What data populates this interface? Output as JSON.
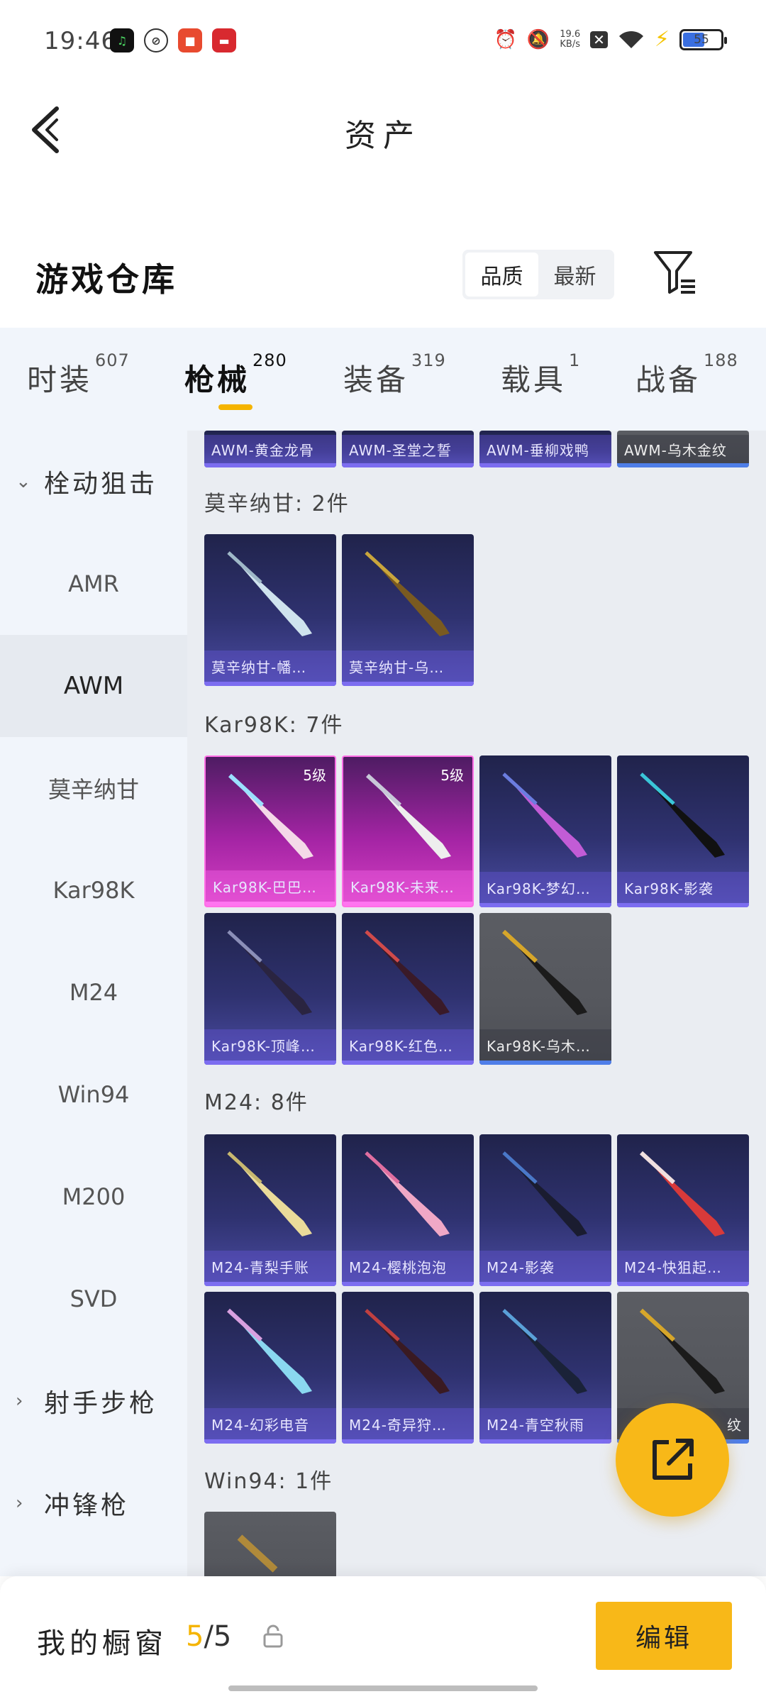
{
  "status_bar": {
    "time": "19:46",
    "network_speed": "19.6",
    "network_unit": "KB/s",
    "battery": "55"
  },
  "header": {
    "title": "资产"
  },
  "warehouse": {
    "title": "游戏仓库",
    "sort_quality": "品质",
    "sort_newest": "最新"
  },
  "tabs": [
    {
      "label": "时装",
      "count": "607"
    },
    {
      "label": "枪械",
      "count": "280"
    },
    {
      "label": "装备",
      "count": "319"
    },
    {
      "label": "载具",
      "count": "1"
    },
    {
      "label": "战备",
      "count": "188"
    }
  ],
  "sidebar": {
    "group_bolt": "栓动狙击",
    "items": [
      "AMR",
      "AWM",
      "莫辛纳甘",
      "Kar98K",
      "M24",
      "Win94",
      "M200",
      "SVD"
    ],
    "group_dmr": "射手步枪",
    "group_smg": "冲锋枪"
  },
  "content": {
    "top_row": [
      "AWM-黄金龙骨",
      "AWM-圣堂之誓",
      "AWM-垂柳戏鸭",
      "AWM-乌木金纹"
    ],
    "sections": [
      {
        "label": "莫辛纳甘: 2件",
        "items": [
          "莫辛纳甘-幡…",
          "莫辛纳甘-乌…"
        ]
      },
      {
        "label": "Kar98K: 7件",
        "items": [
          "Kar98K-巴巴…",
          "Kar98K-未来…",
          "Kar98K-梦幻…",
          "Kar98K-影袭",
          "Kar98K-顶峰…",
          "Kar98K-红色…",
          "Kar98K-乌木…"
        ],
        "levels": [
          "5级",
          "5级"
        ]
      },
      {
        "label": "M24: 8件",
        "items": [
          "M24-青梨手账",
          "M24-樱桃泡泡",
          "M24-影袭",
          "M24-快狙起…",
          "M24-幻彩电音",
          "M24-奇异狩…",
          "M24-青空秋雨",
          "纹"
        ]
      },
      {
        "label": "Win94: 1件",
        "items": []
      }
    ]
  },
  "bottom_bar": {
    "showcase_label": "我的橱窗",
    "showcase_current": "5",
    "showcase_total": "/5",
    "edit_label": "编辑"
  },
  "colors": {
    "accent": "#f8b818",
    "panel": "#f1f5fb",
    "card_purple": "#2f3270",
    "card_pink": "#a424a4",
    "card_gray": "#55575d"
  }
}
